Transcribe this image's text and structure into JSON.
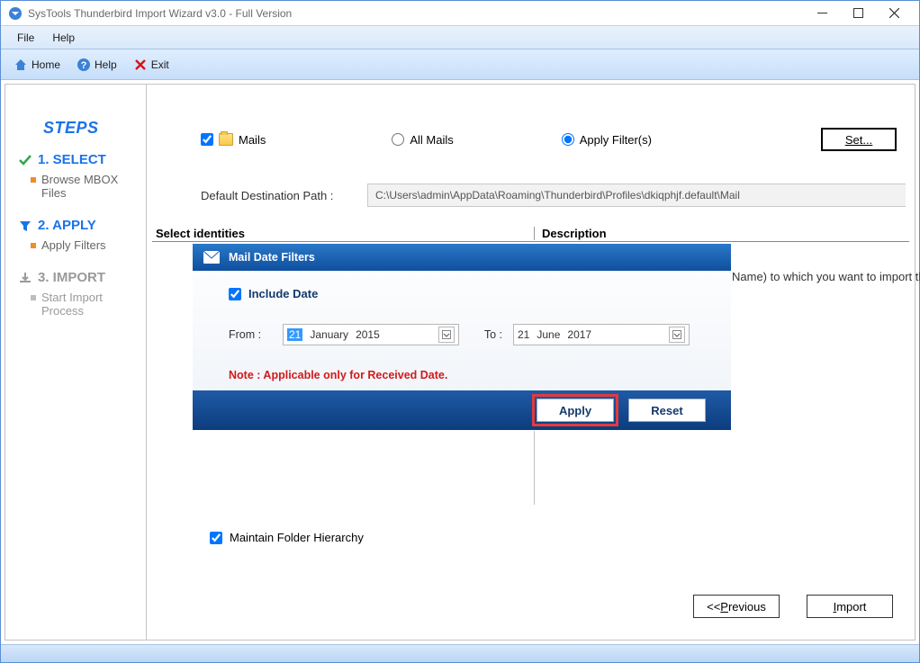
{
  "window": {
    "title": "SysTools Thunderbird Import Wizard v3.0 - Full Version"
  },
  "menubar": {
    "file": "File",
    "help": "Help"
  },
  "toolbar": {
    "home": "Home",
    "help": "Help",
    "exit": "Exit"
  },
  "sidebar": {
    "title": "STEPS",
    "step1": {
      "label": "1. SELECT",
      "sub": "Browse MBOX Files"
    },
    "step2": {
      "label": "2. APPLY",
      "sub": "Apply Filters"
    },
    "step3": {
      "label": "3. IMPORT",
      "sub": "Start Import Process"
    }
  },
  "options": {
    "mails_label": "Mails",
    "all_mails": "All Mails",
    "apply_filters": "Apply Filter(s)",
    "set_btn_prefix": "S",
    "set_btn_rest": "et..."
  },
  "dest": {
    "label": "Default Destination Path :",
    "value": "C:\\Users\\admin\\AppData\\Roaming\\Thunderbird\\Profiles\\dkiqphjf.default\\Mail"
  },
  "sections": {
    "identities": "Select identities",
    "description": "Description"
  },
  "desc_text": "Name) to  which  you want to import the Mbox",
  "dialog": {
    "title": "Mail Date Filters",
    "include": "Include Date",
    "from_label": "From :",
    "to_label": "To :",
    "from": {
      "day": "21",
      "month": "January",
      "year": "2015"
    },
    "to": {
      "day": "21",
      "month": "June",
      "year": "2017"
    },
    "note": "Note : Applicable only for Received Date.",
    "apply": "Apply",
    "reset": "Reset"
  },
  "maintain": "Maintain Folder Hierarchy",
  "nav": {
    "prev_prefix": "<<",
    "prev_u": "P",
    "prev_rest": "revious",
    "import_u": "I",
    "import_rest": "mport"
  }
}
